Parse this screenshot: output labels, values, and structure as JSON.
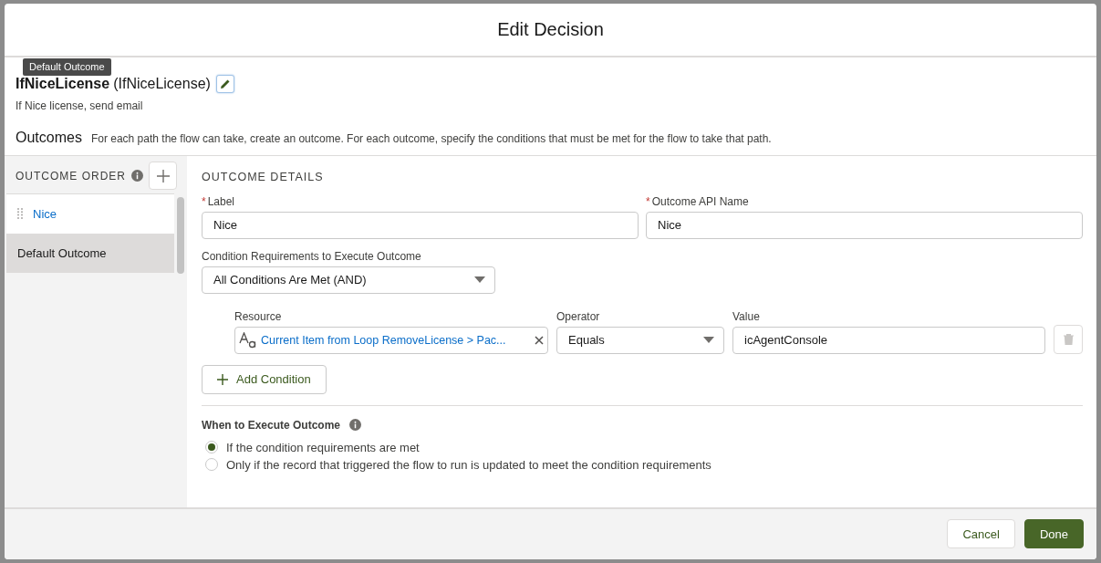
{
  "modal": {
    "title": "Edit Decision"
  },
  "tooltip": {
    "text": "Default Outcome"
  },
  "element": {
    "label": "IfNiceLicense",
    "api_name": "(IfNiceLicense)",
    "description": "If Nice license, send email"
  },
  "outcomes_section": {
    "title": "Outcomes",
    "help": "For each path the flow can take, create an outcome. For each outcome, specify the conditions that must be met for the flow to take that path."
  },
  "outcome_order": {
    "heading": "OUTCOME ORDER",
    "items": [
      {
        "label": "Nice",
        "kind": "draggable",
        "selected": true,
        "hovered": false
      },
      {
        "label": "Default Outcome",
        "kind": "default",
        "selected": false,
        "hovered": true
      }
    ]
  },
  "details": {
    "heading": "OUTCOME DETAILS",
    "label_field": {
      "required_mark": "*",
      "label": "Label",
      "value": "Nice"
    },
    "api_field": {
      "required_mark": "*",
      "label": "Outcome API Name",
      "value": "Nice"
    },
    "requirements": {
      "label": "Condition Requirements to Execute Outcome",
      "value": "All Conditions Are Met (AND)"
    },
    "condition": {
      "resource_label": "Resource",
      "resource": "Current Item from Loop RemoveLicense > Pac...",
      "operator_label": "Operator",
      "operator": "Equals",
      "value_label": "Value",
      "value": "icAgentConsole"
    },
    "add_condition": "Add Condition",
    "when": {
      "title": "When to Execute Outcome",
      "options": [
        {
          "label": "If the condition requirements are met",
          "selected": true
        },
        {
          "label": "Only if the record that triggered the flow to run is updated to meet the condition requirements",
          "selected": false
        }
      ]
    }
  },
  "footer": {
    "buttons": [
      {
        "label": "Cancel",
        "kind": "neutral"
      },
      {
        "label": "Done",
        "kind": "brand"
      }
    ]
  }
}
